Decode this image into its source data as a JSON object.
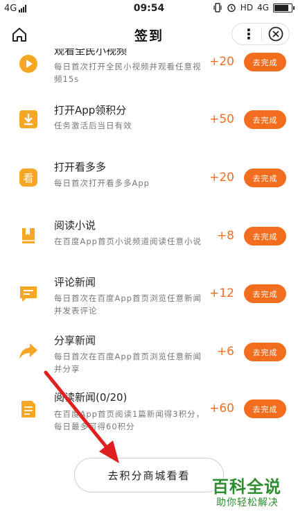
{
  "statusbar": {
    "network": "4G",
    "time": "09:54",
    "hd": "HD",
    "network_right": "4G"
  },
  "header": {
    "title": "签到",
    "more": "⋮"
  },
  "tasks": [
    {
      "title": "观看全民小视频",
      "desc": "每日首次打开全民小视频并观看任意视频15s",
      "points": "+20",
      "button": "去完成",
      "icon": "play-icon",
      "color": "#f5a623"
    },
    {
      "title": "打开App领积分",
      "desc": "任务激活后当日有效",
      "points": "+50",
      "button": "去完成",
      "icon": "download-icon",
      "color": "#f5a623"
    },
    {
      "title": "打开看多多",
      "desc": "每日首次打开看多多App",
      "points": "+20",
      "button": "去完成",
      "icon": "kan-icon",
      "color": "#f5a623"
    },
    {
      "title": "阅读小说",
      "desc": "在百度App首页小说频道阅读任意小说",
      "points": "+8",
      "button": "去完成",
      "icon": "book-icon",
      "color": "#f5a623"
    },
    {
      "title": "评论新闻",
      "desc": "每日首次在百度App首页浏览任意新闻并发表评论",
      "points": "+12",
      "button": "去完成",
      "icon": "comment-icon",
      "color": "#f5a623"
    },
    {
      "title": "分享新闻",
      "desc": "每日首次在百度App首页浏览任意新闻并分享",
      "points": "+6",
      "button": "去完成",
      "icon": "share-icon",
      "color": "#f5a623"
    },
    {
      "title": "阅读新闻(0/20)",
      "desc": "在百度App首页阅读1篇新闻得3积分，每日最多可得60积分",
      "points": "+60",
      "button": "去完成",
      "icon": "document-icon",
      "color": "#f5a623"
    }
  ],
  "mall_button": "去积分商城看看",
  "watermark": {
    "main": "百科全说",
    "sub": "助你轻松解决"
  },
  "colors": {
    "accent": "#f36d1e",
    "icon": "#f5a623",
    "watermark": "#2e8b2e"
  }
}
